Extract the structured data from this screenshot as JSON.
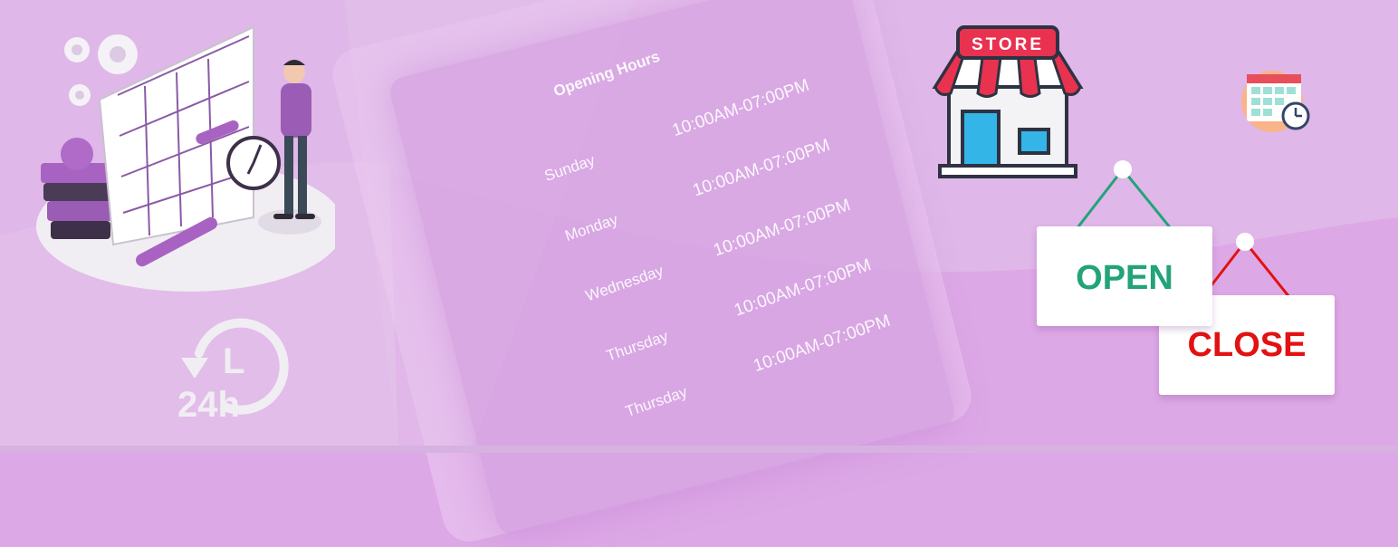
{
  "opening_hours": {
    "title": "Opening Hours",
    "rows": [
      {
        "day": "Sunday",
        "time": "10:00AM-07:00PM"
      },
      {
        "day": "Monday",
        "time": "10:00AM-07:00PM"
      },
      {
        "day": "Wednesday",
        "time": "10:00AM-07:00PM"
      },
      {
        "day": "Thursday",
        "time": "10:00AM-07:00PM"
      },
      {
        "day": "Thursday",
        "time": "10:00AM-07:00PM"
      }
    ]
  },
  "store_sign": "STORE",
  "icon_24h": {
    "hours": "24h",
    "letter": "L"
  },
  "signs": {
    "open": "OPEN",
    "close": "CLOSE"
  },
  "colors": {
    "background": "#dda8e6",
    "open_green": "#22a37a",
    "close_red": "#e21212",
    "store_red": "#e8324f",
    "store_blue": "#33b5e8"
  },
  "icons": [
    "calendar-planning-illustration",
    "clock-24h-icon",
    "store-icon",
    "calendar-clock-icon",
    "open-sign-icon",
    "close-sign-icon"
  ]
}
